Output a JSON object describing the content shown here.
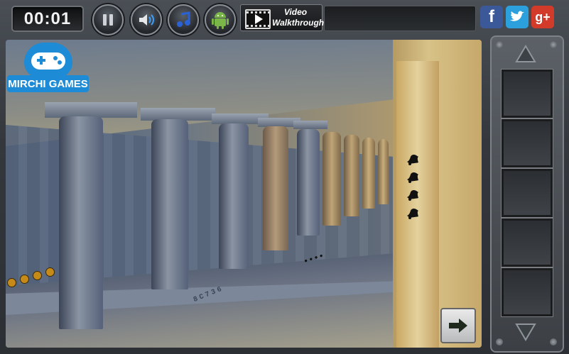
{
  "timer": "00:01",
  "toolbar": {
    "pause_icon": "pause-icon",
    "sound_icon": "speaker-icon",
    "music_icon": "music-note-icon",
    "android_icon": "android-icon",
    "walkthrough_line1": "Video",
    "walkthrough_line2": "Walkthrough"
  },
  "social": {
    "facebook": "f",
    "twitter": "twitter-bird-icon",
    "googleplus": "g+"
  },
  "logo": {
    "text": "MIRCHI GAMES",
    "icon": "gamepad-icon"
  },
  "scene": {
    "wall_code": "8C736",
    "dot_clue": "• • • •",
    "bells": 4,
    "coins": 4
  },
  "inventory": {
    "slots": 5,
    "up_icon": "arrow-up-icon",
    "down_icon": "arrow-down-icon"
  },
  "next_icon": "arrow-right-icon",
  "colors": {
    "accent": "#1d8bd6",
    "facebook": "#3b5998",
    "twitter": "#2ba0dc",
    "googleplus": "#d23a2a",
    "android": "#7ab648",
    "music": "#2a62d6"
  }
}
